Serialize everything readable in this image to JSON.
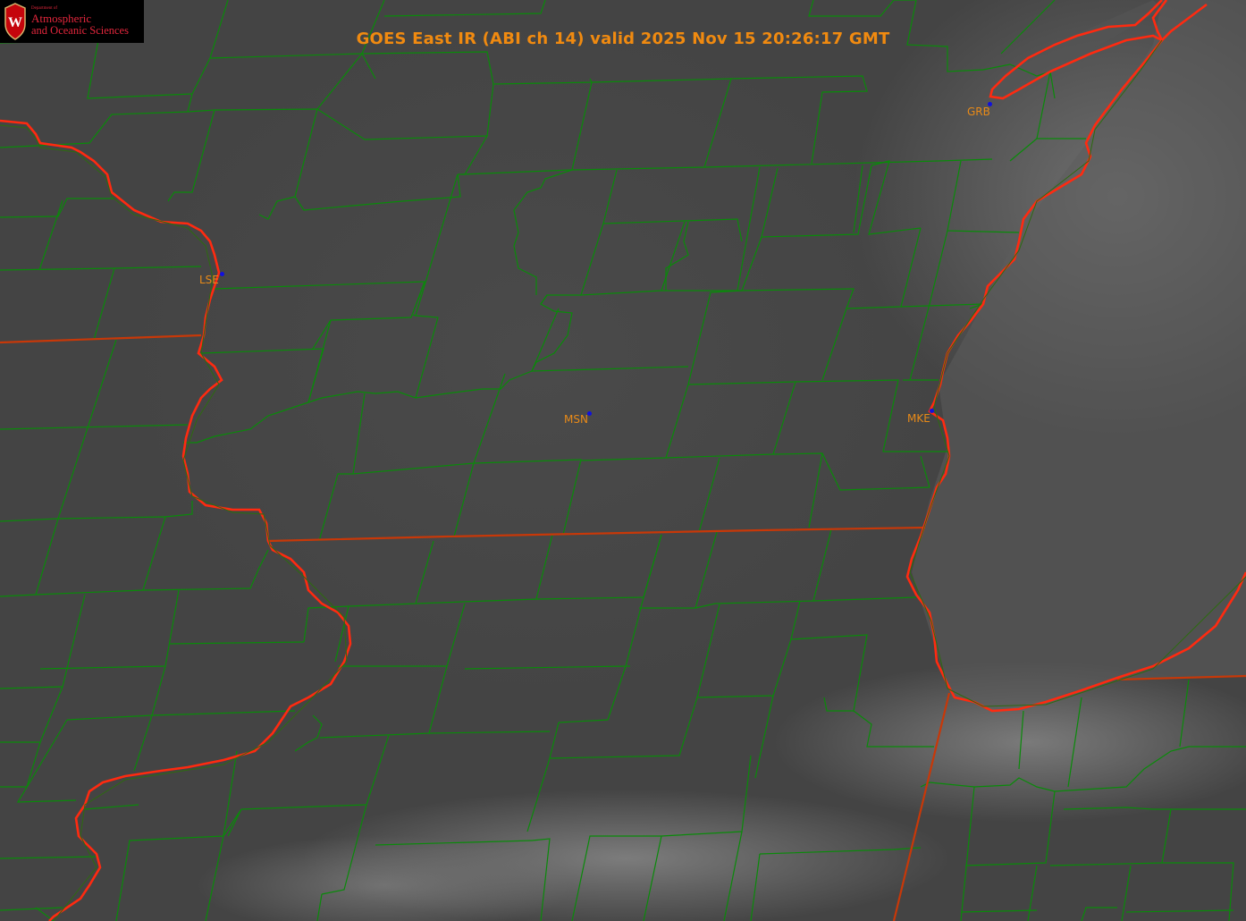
{
  "title": "GOES East IR (ABI ch 14) valid 2025 Nov 15 20:26:17 GMT",
  "logo": {
    "dept": "Department of",
    "line1": "Atmospheric",
    "line2": "and Oceanic Sciences",
    "crest_letter": "W"
  },
  "stations": [
    {
      "id": "lse",
      "label": "LSE"
    },
    {
      "id": "msn",
      "label": "MSN"
    },
    {
      "id": "mke",
      "label": "MKE"
    },
    {
      "id": "grb",
      "label": "GRB"
    }
  ],
  "colors": {
    "county_lines": "#0a8a0a",
    "state_lines": "#c83808",
    "coastline": "#ff2a10",
    "station_label": "#e88a18",
    "station_marker": "#1010e0",
    "title": "#f08a10"
  }
}
